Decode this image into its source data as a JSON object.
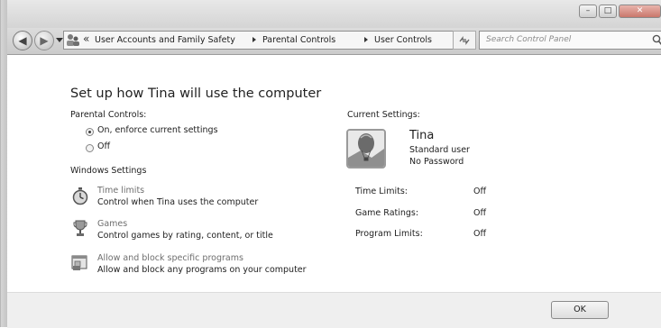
{
  "window": {
    "buttons": {
      "minimize": "–",
      "maximize": "□",
      "close": "✕"
    }
  },
  "nav": {
    "back_icon": "back-arrow-icon",
    "forward_icon": "forward-arrow-icon",
    "address": {
      "overflow": "«",
      "breadcrumbs": [
        "User Accounts and Family Safety",
        "Parental Controls",
        "User Controls"
      ]
    },
    "refresh_glyph": "⁴⁄₅",
    "search": {
      "placeholder": "Search Control Panel"
    }
  },
  "help_glyph": "?",
  "main": {
    "title": "Set up how Tina will use the computer",
    "parental_controls": {
      "label": "Parental Controls:",
      "options": [
        {
          "label": "On, enforce current settings",
          "selected": true
        },
        {
          "label": "Off",
          "selected": false
        }
      ]
    },
    "windows_settings": {
      "label": "Windows Settings",
      "items": [
        {
          "title": "Time limits",
          "desc": "Control when Tina uses the computer",
          "icon": "stopwatch-icon"
        },
        {
          "title": "Games",
          "desc": "Control games by rating, content, or title",
          "icon": "trophy-icon"
        },
        {
          "title": "Allow and block specific programs",
          "desc": "Allow and block any programs on your computer",
          "icon": "program-window-icon"
        }
      ]
    },
    "current_settings": {
      "label": "Current Settings:",
      "user": {
        "name": "Tina",
        "type": "Standard user",
        "password": "No Password"
      },
      "rows": [
        {
          "label": "Time Limits:",
          "value": "Off"
        },
        {
          "label": "Game Ratings:",
          "value": "Off"
        },
        {
          "label": "Program Limits:",
          "value": "Off"
        }
      ]
    }
  },
  "footer": {
    "ok_label": "OK"
  }
}
